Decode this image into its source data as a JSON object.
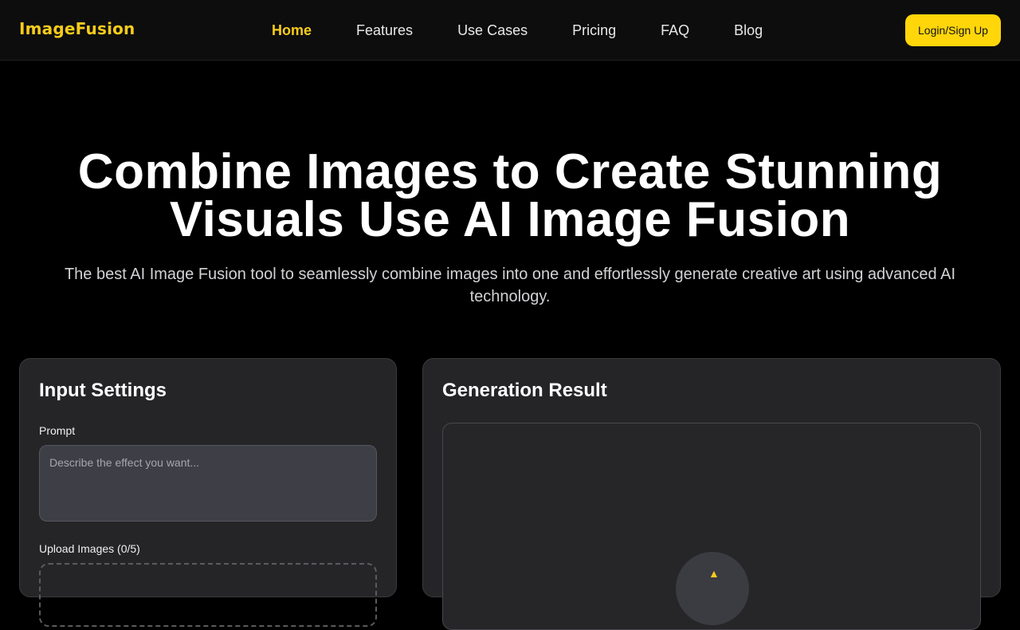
{
  "nav": {
    "logo": "ImageFusion",
    "links": [
      "Home",
      "Features",
      "Use Cases",
      "Pricing",
      "FAQ",
      "Blog"
    ],
    "active_link": "Home",
    "login_label": "Login/Sign Up"
  },
  "hero": {
    "title_line1": "Combine Images to Create Stunning",
    "title_line2": "Visuals Use AI Image Fusion",
    "subtitle": "The best AI Image Fusion tool to seamlessly combine images into one and effortlessly generate creative art using advanced AI technology."
  },
  "input_panel": {
    "title": "Input Settings",
    "prompt_label": "Prompt",
    "prompt_placeholder": "Describe the effect you want...",
    "prompt_value": "",
    "upload_label": "Upload Images (0/5)"
  },
  "result_panel": {
    "title": "Generation Result",
    "icon": "sparkle-icon"
  },
  "colors": {
    "accent": "#f7cc1b",
    "button": "#ffd60a",
    "panel": "#252527",
    "background": "#000000"
  }
}
